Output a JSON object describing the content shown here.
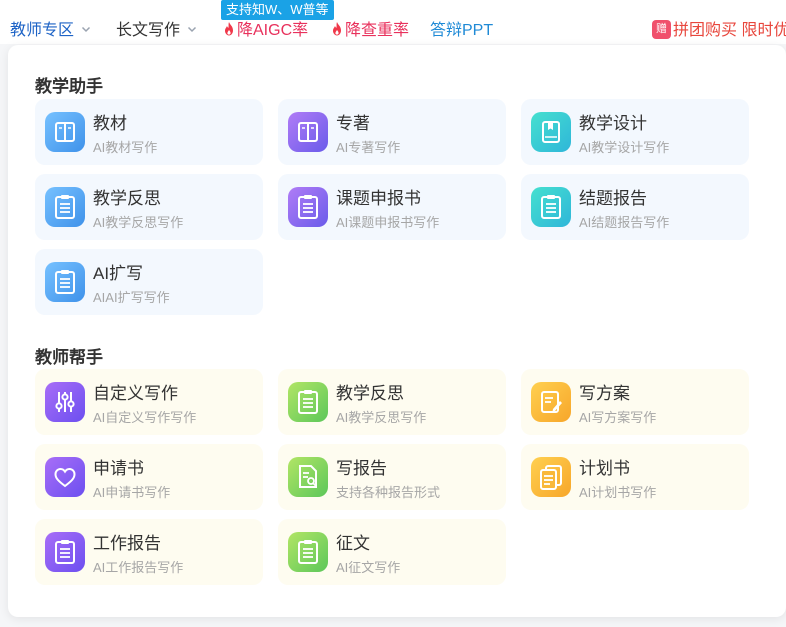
{
  "nav": {
    "teacher_zone": "教师专区",
    "long_writing": "长文写作",
    "badge": "支持知W、W普等",
    "reduce_aigc": "降AIGC率",
    "reduce_dup": "降查重率",
    "defense_ppt": "答辩PPT",
    "gift_icon_text": "赠",
    "group_buy": "拼团购买 限时优"
  },
  "sections": [
    {
      "title": "教学助手",
      "items": [
        {
          "title": "教材",
          "subtitle": "AI教材写作",
          "icon": "book-icon",
          "color": "#4aa3f2"
        },
        {
          "title": "专著",
          "subtitle": "AI专著写作",
          "icon": "book-icon",
          "color": "#8c6cf2"
        },
        {
          "title": "教学设计",
          "subtitle": "AI教学设计写作",
          "icon": "bookmark-book-icon",
          "color": "#37c8d8"
        },
        {
          "title": "教学反思",
          "subtitle": "AI教学反思写作",
          "icon": "clipboard-icon",
          "color": "#4aa3f2"
        },
        {
          "title": "课题申报书",
          "subtitle": "AI课题申报书写作",
          "icon": "clipboard-icon",
          "color": "#8c6cf2"
        },
        {
          "title": "结题报告",
          "subtitle": "AI结题报告写作",
          "icon": "clipboard-icon",
          "color": "#37c8d8"
        },
        {
          "title": "AI扩写",
          "subtitle": "AIAI扩写写作",
          "icon": "clipboard-icon",
          "color": "#4aa3f2"
        }
      ]
    },
    {
      "title": "教师帮手",
      "items": [
        {
          "title": "自定义写作",
          "subtitle": "AI自定义写作写作",
          "icon": "sliders-icon",
          "color": "#7e5cf0"
        },
        {
          "title": "教学反思",
          "subtitle": "AI教学反思写作",
          "icon": "clipboard-icon",
          "color": "#6cc95a"
        },
        {
          "title": "写方案",
          "subtitle": "AI写方案写作",
          "icon": "edit-document-icon",
          "color": "#f7b030"
        },
        {
          "title": "申请书",
          "subtitle": "AI申请书写作",
          "icon": "heart-icon",
          "color": "#7e5cf0"
        },
        {
          "title": "写报告",
          "subtitle": "支持各种报告形式",
          "icon": "search-document-icon",
          "color": "#6cc95a"
        },
        {
          "title": "计划书",
          "subtitle": "AI计划书写作",
          "icon": "stacked-documents-icon",
          "color": "#f7b030"
        },
        {
          "title": "工作报告",
          "subtitle": "AI工作报告写作",
          "icon": "clipboard-icon",
          "color": "#7e5cf0"
        },
        {
          "title": "征文",
          "subtitle": "AI征文写作",
          "icon": "clipboard-icon",
          "color": "#6cc95a"
        }
      ]
    }
  ]
}
